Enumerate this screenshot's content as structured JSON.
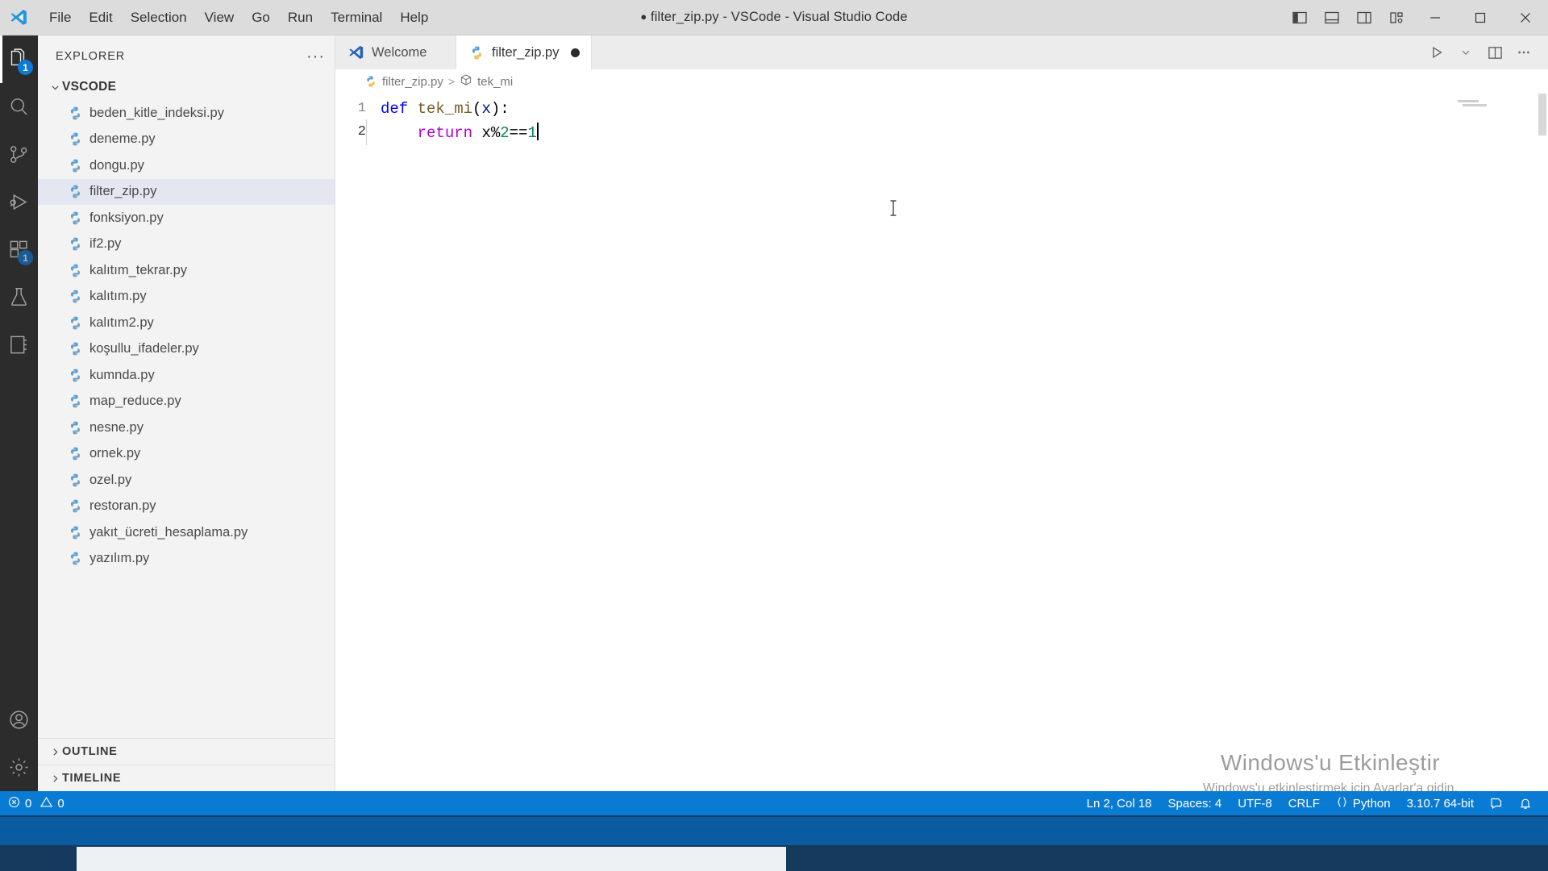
{
  "window": {
    "title": "filter_zip.py - VSCode - Visual Studio Code",
    "dirty_marker": "●",
    "accent_blue": "#0a7bd2",
    "titlebar_bg": "#dcdcdc"
  },
  "menu": {
    "items": [
      {
        "label": "File"
      },
      {
        "label": "Edit"
      },
      {
        "label": "Selection"
      },
      {
        "label": "View"
      },
      {
        "label": "Go"
      },
      {
        "label": "Run"
      },
      {
        "label": "Terminal"
      },
      {
        "label": "Help"
      }
    ]
  },
  "titlebar_right": {
    "layout_icons": [
      "toggle-primary-sidebar-icon",
      "toggle-panel-icon",
      "toggle-secondary-sidebar-icon",
      "customize-layout-icon"
    ],
    "window_controls": [
      "minimize-icon",
      "maximize-icon",
      "close-icon"
    ]
  },
  "activitybar": {
    "items": [
      {
        "name": "explorer",
        "icon": "files-icon",
        "badge": "1",
        "active": true
      },
      {
        "name": "search",
        "icon": "search-icon",
        "badge": "",
        "active": false
      },
      {
        "name": "source-control",
        "icon": "source-control-icon",
        "badge": "",
        "active": false
      },
      {
        "name": "run-and-debug",
        "icon": "run-debug-icon",
        "badge": "",
        "active": false
      },
      {
        "name": "extensions",
        "icon": "extensions-icon",
        "badge": "1",
        "active": false
      },
      {
        "name": "testing",
        "icon": "beaker-icon",
        "badge": "",
        "active": false
      },
      {
        "name": "notebook",
        "icon": "notebook-icon",
        "badge": "",
        "active": false
      }
    ],
    "bottom": [
      {
        "name": "accounts",
        "icon": "account-icon"
      },
      {
        "name": "manage",
        "icon": "gear-icon"
      }
    ]
  },
  "sidebar": {
    "header": "EXPLORER",
    "more_actions": "···",
    "folder": "VSCODE",
    "files": [
      {
        "name": "beden_kitle_indeksi.py",
        "selected": false
      },
      {
        "name": "deneme.py",
        "selected": false
      },
      {
        "name": "dongu.py",
        "selected": false
      },
      {
        "name": "filter_zip.py",
        "selected": true
      },
      {
        "name": "fonksiyon.py",
        "selected": false
      },
      {
        "name": "if2.py",
        "selected": false
      },
      {
        "name": "kalıtım_tekrar.py",
        "selected": false
      },
      {
        "name": "kalıtım.py",
        "selected": false
      },
      {
        "name": "kalıtım2.py",
        "selected": false
      },
      {
        "name": "koşullu_ifadeler.py",
        "selected": false
      },
      {
        "name": "kumnda.py",
        "selected": false
      },
      {
        "name": "map_reduce.py",
        "selected": false
      },
      {
        "name": "nesne.py",
        "selected": false
      },
      {
        "name": "ornek.py",
        "selected": false
      },
      {
        "name": "ozel.py",
        "selected": false
      },
      {
        "name": "restoran.py",
        "selected": false
      },
      {
        "name": "yakıt_ücreti_hesaplama.py",
        "selected": false
      },
      {
        "name": "yazılım.py",
        "selected": false
      }
    ],
    "panels": [
      {
        "label": "OUTLINE"
      },
      {
        "label": "TIMELINE"
      }
    ]
  },
  "editor": {
    "tabs": [
      {
        "label": "Welcome",
        "icon": "vscode-logo-icon",
        "active": false,
        "dirty": false
      },
      {
        "label": "filter_zip.py",
        "icon": "python-icon",
        "active": true,
        "dirty": true
      }
    ],
    "tab_actions": [
      {
        "name": "run-python-file",
        "icon": "play-icon"
      },
      {
        "name": "run-options",
        "icon": "chevron-down-icon"
      },
      {
        "name": "split-editor",
        "icon": "split-editor-icon"
      },
      {
        "name": "more-actions",
        "icon": "ellipsis-icon"
      }
    ],
    "breadcrumb": [
      {
        "label": "filter_zip.py",
        "icon": "python-icon"
      },
      {
        "label": "tek_mi",
        "icon": "symbol-method-icon"
      }
    ],
    "lines": [
      {
        "number": "1",
        "tokens": [
          {
            "t": "def",
            "c": "kw"
          },
          {
            "t": " ",
            "c": "punc"
          },
          {
            "t": "tek_mi",
            "c": "fn"
          },
          {
            "t": "(",
            "c": "punc"
          },
          {
            "t": "x",
            "c": "param"
          },
          {
            "t": "):",
            "c": "punc"
          }
        ]
      },
      {
        "number": "2",
        "tokens": [
          {
            "t": "    ",
            "c": "punc"
          },
          {
            "t": "return",
            "c": "kw2"
          },
          {
            "t": " ",
            "c": "punc"
          },
          {
            "t": "x",
            "c": "punc"
          },
          {
            "t": "%",
            "c": "op"
          },
          {
            "t": "2",
            "c": "num"
          },
          {
            "t": "==",
            "c": "op"
          },
          {
            "t": "1",
            "c": "num"
          }
        ]
      }
    ]
  },
  "watermark": {
    "line1": "Windows'u Etkinleştir",
    "line2": "Windows'u etkinleştirmek için Ayarlar'a gidin."
  },
  "statusbar": {
    "left": [
      {
        "name": "errors",
        "icon": "error-icon",
        "value": "0"
      },
      {
        "name": "warnings",
        "icon": "warning-icon",
        "value": "0"
      }
    ],
    "right": [
      {
        "name": "cursor-position",
        "label": "Ln 2, Col 18"
      },
      {
        "name": "indentation",
        "label": "Spaces: 4"
      },
      {
        "name": "encoding",
        "label": "UTF-8"
      },
      {
        "name": "eol",
        "label": "CRLF"
      },
      {
        "name": "language-mode",
        "label": "Python",
        "icon": "braces-icon"
      },
      {
        "name": "python-interpreter",
        "label": "3.10.7 64-bit"
      },
      {
        "name": "feedback",
        "label": "",
        "icon": "feedback-icon"
      },
      {
        "name": "notifications",
        "label": "",
        "icon": "bell-icon"
      }
    ]
  }
}
